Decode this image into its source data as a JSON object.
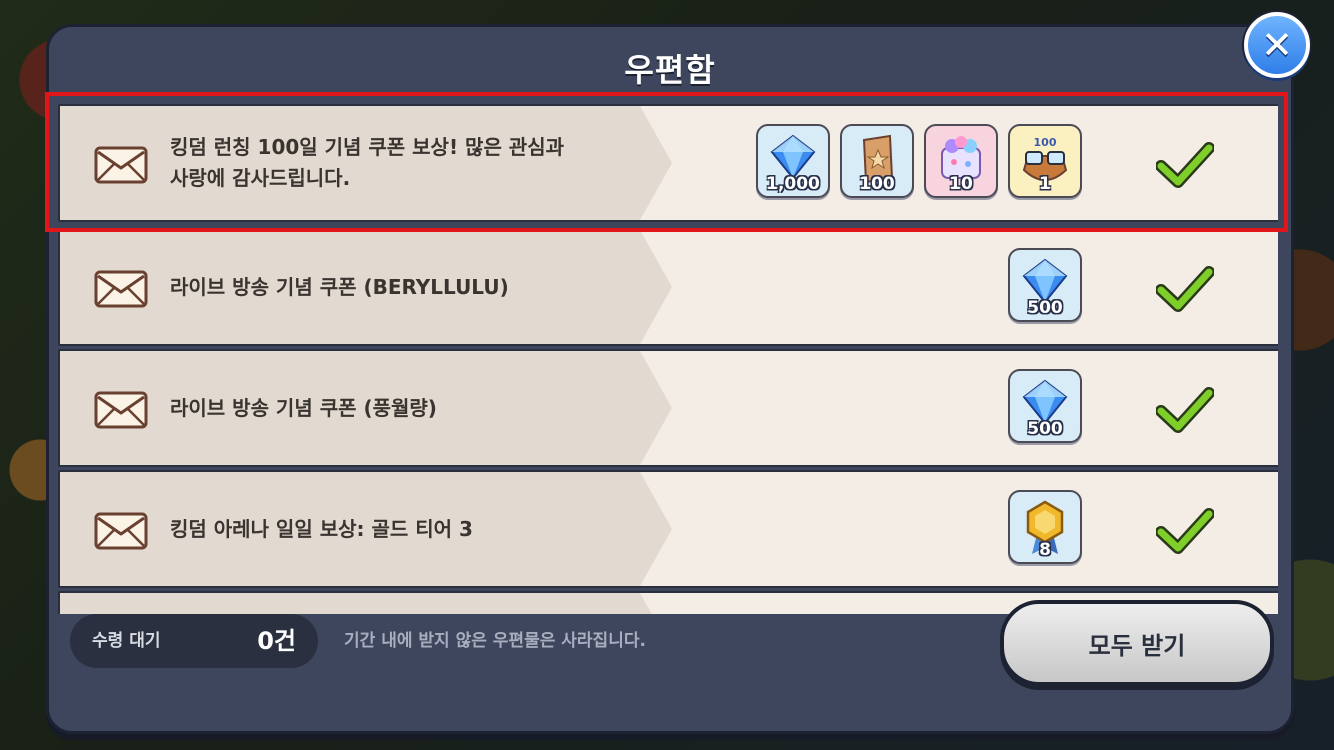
{
  "mailbox": {
    "title": "우편함",
    "close_icon": "close-x-icon",
    "items": [
      {
        "title_line1": "킹덤 런칭 100일 기념 쿠폰 보상!  많은 관심과",
        "title_line2": "사랑에 감사드립니다.",
        "rewards": [
          {
            "icon": "crystal-icon",
            "qty": "1,000"
          },
          {
            "icon": "rainbow-cube-ticket-icon",
            "qty": "100"
          },
          {
            "icon": "gingerbrave-costume-box-icon",
            "qty": "10"
          },
          {
            "icon": "100-day-glasses-icon",
            "qty": "1"
          }
        ]
      },
      {
        "title_line1": "라이브 방송 기념 쿠폰 (BERYLLULU)",
        "title_line2": "",
        "rewards": [
          {
            "icon": "crystal-icon",
            "qty": "500"
          }
        ]
      },
      {
        "title_line1": "라이브 방송 기념 쿠폰 (풍월량)",
        "title_line2": "",
        "rewards": [
          {
            "icon": "crystal-icon",
            "qty": "500"
          }
        ]
      },
      {
        "title_line1": "킹덤 아레나 일일 보상: 골드 티어 3",
        "title_line2": "",
        "rewards": [
          {
            "icon": "arena-medal-icon",
            "qty": "8"
          }
        ]
      }
    ]
  },
  "footer": {
    "pending_label": "수령 대기",
    "pending_count": "0건",
    "notice": "기간 내에 받지 않은 우편물은 사라집니다.",
    "claim_all_label": "모두 받기"
  },
  "colors": {
    "highlight": "#e0161b",
    "check": "#7fcf2a",
    "close_button": "#2f7ee8"
  }
}
